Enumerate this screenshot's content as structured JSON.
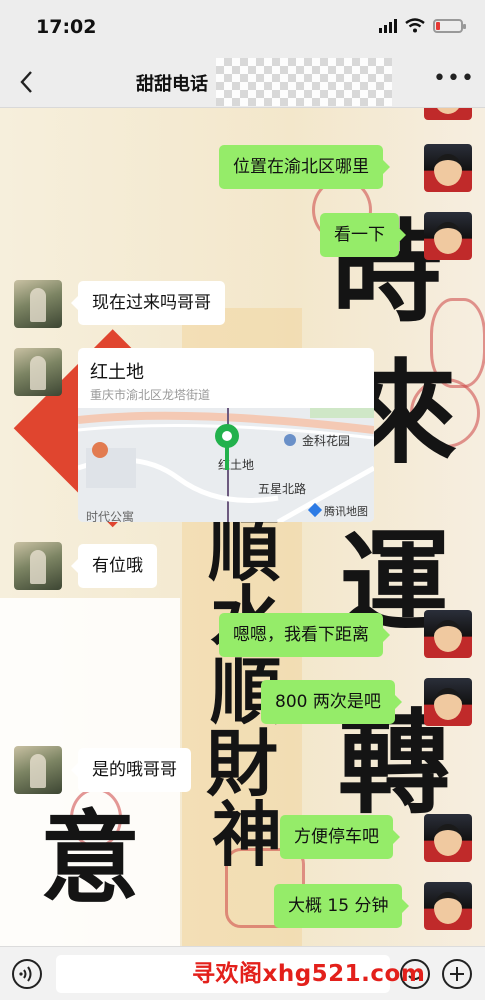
{
  "status_bar": {
    "time": "17:02",
    "battery_level": 0.18,
    "battery_color": "#e53935"
  },
  "nav": {
    "title": "甜甜电话",
    "back_icon": "chevron-left-icon",
    "more_icon": "more-dots-icon"
  },
  "messages": [
    {
      "side": "out",
      "type": "text",
      "text": "位置在渝北区哪里"
    },
    {
      "side": "out",
      "type": "text",
      "text": "看一下"
    },
    {
      "side": "in",
      "type": "text",
      "text": "现在过来吗哥哥"
    },
    {
      "side": "in",
      "type": "location",
      "title": "红土地",
      "address": "重庆市渝北区龙塔街道",
      "map": {
        "pin_label": "红土地",
        "poi": "金科花园",
        "road": "五星北路",
        "brand": "腾讯地图",
        "partial_label": "时代公寓"
      }
    },
    {
      "side": "in",
      "type": "text",
      "text": "有位哦"
    },
    {
      "side": "out",
      "type": "text",
      "text": "嗯嗯，我看下距离"
    },
    {
      "side": "out",
      "type": "text",
      "text": "800 两次是吧"
    },
    {
      "side": "in",
      "type": "text",
      "text": "是的哦哥哥"
    },
    {
      "side": "out",
      "type": "text",
      "text": "方便停车吧"
    },
    {
      "side": "out",
      "type": "text",
      "text": "大概 15 分钟"
    }
  ],
  "wallpaper": {
    "chars": [
      "時",
      "來",
      "運",
      "轉",
      "順",
      "水",
      "順",
      "財",
      "神",
      "意"
    ]
  },
  "input_bar": {
    "voice_icon": "voice-icon",
    "emoji_icon": "emoji-icon",
    "add_icon": "plus-icon"
  },
  "watermark": "寻欢阁xhg521.com",
  "colors": {
    "outgoing_bubble": "#95ec69",
    "incoming_bubble": "#ffffff",
    "map_pin": "#22b14c"
  }
}
